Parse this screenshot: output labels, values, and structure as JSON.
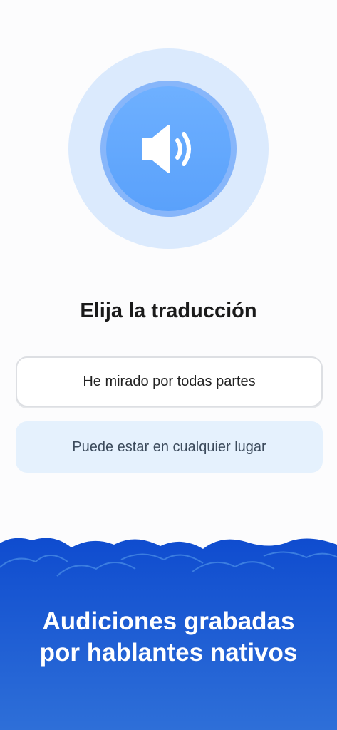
{
  "exercise": {
    "prompt": "Elija la traducción",
    "options": [
      {
        "label": "He mirado por todas partes",
        "state": "default"
      },
      {
        "label": "Puede estar en cualquier lugar",
        "state": "highlighted"
      }
    ]
  },
  "banner": {
    "line1": "Audiciones grabadas",
    "line2": "por hablantes nativos"
  },
  "icons": {
    "play_audio": "speaker-icon"
  },
  "colors": {
    "accent_blue": "#5aa1fb",
    "banner_blue": "#1550d0",
    "option_highlight": "#e5f1fd"
  }
}
